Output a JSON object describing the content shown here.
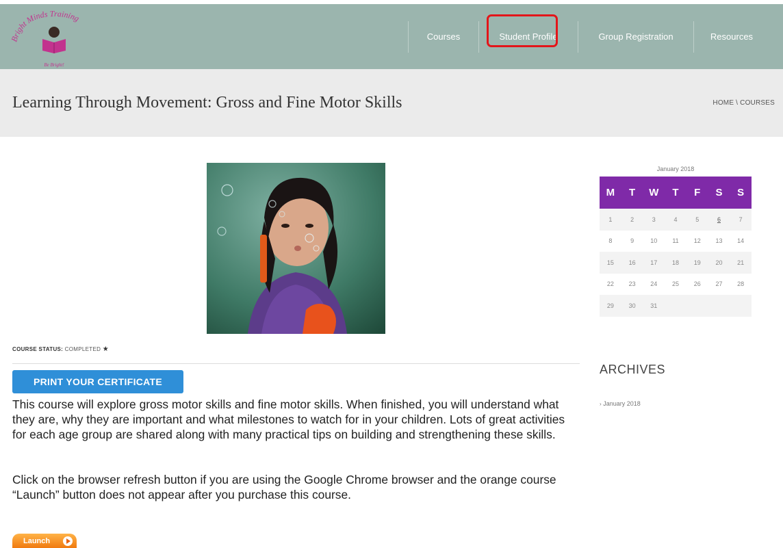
{
  "header": {
    "logo_text": "Bright Minds Training",
    "logo_tagline": "Be Bright!",
    "nav": [
      {
        "label": "Courses"
      },
      {
        "label": "Student Profile"
      },
      {
        "label": "Group Registration"
      },
      {
        "label": "Resources"
      }
    ],
    "colors": {
      "header_bg": "#9bb5ae",
      "highlight": "#e3151a"
    }
  },
  "title_bar": {
    "title": "Learning Through Movement: Gross and Fine Motor Skills",
    "breadcrumb": "HOME \\ COURSES"
  },
  "course": {
    "status_label": "COURSE STATUS:",
    "status_value": "COMPLETED",
    "print_button": "PRINT YOUR CERTIFICATE",
    "description": "This course will explore gross motor skills and fine motor skills.  When finished, you will understand what they are, why they are important and what milestones to watch for in your children.  Lots of great activities for each age group are shared along with many practical tips on building and strengthening these skills.",
    "note": "Click on the browser refresh button if you are using the Google Chrome browser and the orange course “Launch” button does not appear after you purchase this course.",
    "launch_button": "Launch"
  },
  "calendar": {
    "caption": "January 2018",
    "days": [
      "M",
      "T",
      "W",
      "T",
      "F",
      "S",
      "S"
    ],
    "weeks": [
      [
        "1",
        "2",
        "3",
        "4",
        "5",
        "6",
        "7"
      ],
      [
        "8",
        "9",
        "10",
        "11",
        "12",
        "13",
        "14"
      ],
      [
        "15",
        "16",
        "17",
        "18",
        "19",
        "20",
        "21"
      ],
      [
        "22",
        "23",
        "24",
        "25",
        "26",
        "27",
        "28"
      ],
      [
        "29",
        "30",
        "31",
        "",
        "",
        "",
        ""
      ]
    ],
    "linked_day": "6",
    "head_color": "#7f2aa8"
  },
  "archives": {
    "title": "ARCHIVES",
    "items": [
      "January 2018"
    ]
  }
}
